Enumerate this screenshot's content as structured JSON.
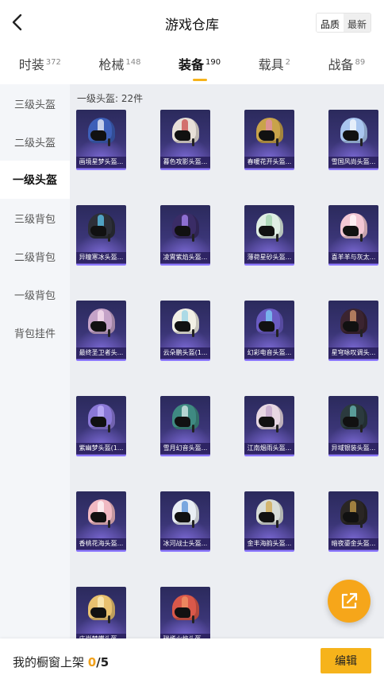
{
  "header": {
    "title": "游戏仓库",
    "sort_options": [
      "品质",
      "最新"
    ]
  },
  "tabs": [
    {
      "label": "时装",
      "count": "372",
      "active": false
    },
    {
      "label": "枪械",
      "count": "148",
      "active": false
    },
    {
      "label": "装备",
      "count": "190",
      "active": true
    },
    {
      "label": "载具",
      "count": "2",
      "active": false
    },
    {
      "label": "战备",
      "count": "89",
      "active": false
    }
  ],
  "sidebar": {
    "items": [
      {
        "label": "三级头盔",
        "active": false
      },
      {
        "label": "二级头盔",
        "active": false
      },
      {
        "label": "一级头盔",
        "active": true
      },
      {
        "label": "三级背包",
        "active": false
      },
      {
        "label": "二级背包",
        "active": false
      },
      {
        "label": "一级背包",
        "active": false
      },
      {
        "label": "背包挂件",
        "active": false
      }
    ]
  },
  "section": {
    "title": "一级头盔: 22件"
  },
  "items": [
    {
      "name": "画境星梦头盔...",
      "shell": "#3d5fb8",
      "stripe": "#ffffff"
    },
    {
      "name": "暮色攻影头盔...",
      "shell": "#e8e0d8",
      "stripe": "#c94040"
    },
    {
      "name": "春暖花开头盔...",
      "shell": "#c9a34a",
      "stripe": "#e48ab0"
    },
    {
      "name": "雪国风尚头盔...",
      "shell": "#a9c6ef",
      "stripe": "#ffffff"
    },
    {
      "name": "异瞳寒冰头盔...",
      "shell": "#2d2f38",
      "stripe": "#5fd3ff"
    },
    {
      "name": "凌霄紫焰头盔...",
      "shell": "#3a2c66",
      "stripe": "#b28cff"
    },
    {
      "name": "薄荷星砂头盔...",
      "shell": "#dfeee4",
      "stripe": "#9bd0a8"
    },
    {
      "name": "喜羊羊与灰太...",
      "shell": "#f3c7d4",
      "stripe": "#ffffff"
    },
    {
      "name": "最终圣卫者头...",
      "shell": "#c5a3c8",
      "stripe": "#ffe7f3"
    },
    {
      "name": "云朵鹏头盔(1...",
      "shell": "#f2f0e6",
      "stripe": "#8fd0e6"
    },
    {
      "name": "幻彩电音头盔...",
      "shell": "#6a5bc2",
      "stripe": "#7fd7ff"
    },
    {
      "name": "星穹咏叹调头...",
      "shell": "#3b2430",
      "stripe": "#e3a070"
    },
    {
      "name": "紫幽梦头盔(1...",
      "shell": "#8a78d6",
      "stripe": "#c6b8ff"
    },
    {
      "name": "雪月幻音头盔...",
      "shell": "#3f8a82",
      "stripe": "#e8f5f4"
    },
    {
      "name": "江南烟雨头盔...",
      "shell": "#e7d7e3",
      "stripe": "#bda0c8"
    },
    {
      "name": "异域银装头盔...",
      "shell": "#2b3a3e",
      "stripe": "#6fc6c0"
    },
    {
      "name": "香桃花海头盔...",
      "shell": "#f0b9c2",
      "stripe": "#ffffff"
    },
    {
      "name": "冰河战士头盔...",
      "shell": "#e9eef5",
      "stripe": "#4a89d6"
    },
    {
      "name": "金丰海韵头盔...",
      "shell": "#d8ddd8",
      "stripe": "#d1a544"
    },
    {
      "name": "暗夜鎏金头盔...",
      "shell": "#2a2624",
      "stripe": "#d3a64b"
    },
    {
      "name": "庄尚梦蝶头盔...",
      "shell": "#e8c16f",
      "stripe": "#fff2c4"
    },
    {
      "name": "瑞烯火焰头盔...",
      "shell": "#d9584a",
      "stripe": "#f29a68"
    }
  ],
  "bottom_bar": {
    "label": "我的橱窗上架",
    "current": "0",
    "total": "/5",
    "edit_label": "编辑"
  },
  "icons": {
    "back": "chevron-left-icon",
    "share": "share-external-icon"
  },
  "colors": {
    "accent": "#f6b31b",
    "card_bg": "#3a3576"
  }
}
